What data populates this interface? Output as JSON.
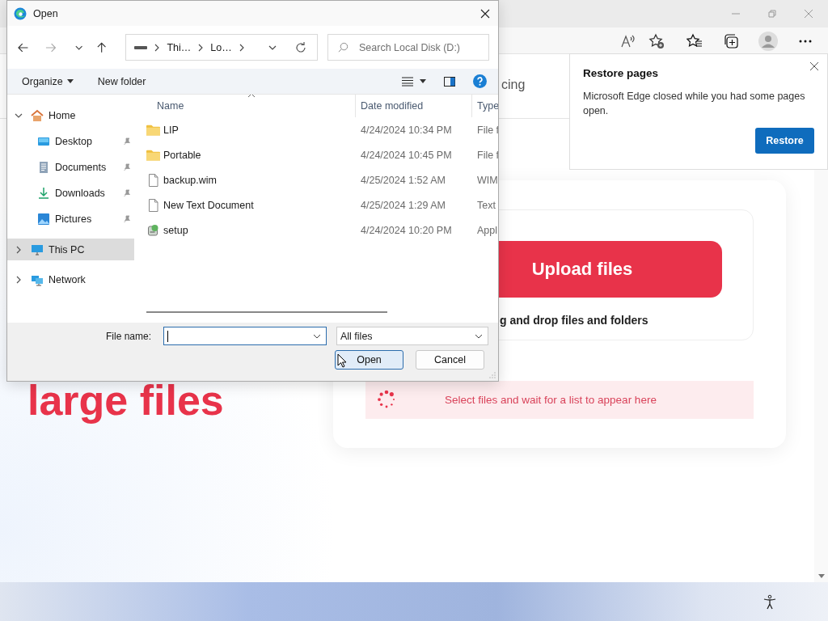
{
  "browser": {
    "page": {
      "nav_fragment": "cing",
      "heading": "large files",
      "upload_button": "Upload files",
      "drop_hint": "g and drop files and folders",
      "status": "Select files and wait for a list to appear here"
    },
    "popup": {
      "title": "Restore pages",
      "message": "Microsoft Edge closed while you had some pages open.",
      "button": "Restore"
    }
  },
  "dialog": {
    "title": "Open",
    "breadcrumb": [
      "Thi…",
      "Lo…"
    ],
    "search": {
      "placeholder": "Search Local Disk (D:)"
    },
    "commands": [
      "Organize",
      "New folder"
    ],
    "nav": [
      {
        "label": "Home",
        "kind": "home",
        "selected": false,
        "expanded": true,
        "children": [
          {
            "label": "Desktop",
            "kind": "desktop",
            "pinned": true,
            "selected": false
          },
          {
            "label": "Documents",
            "kind": "documents",
            "pinned": true,
            "selected": false
          },
          {
            "label": "Downloads",
            "kind": "downloads",
            "pinned": true,
            "selected": false
          },
          {
            "label": "Pictures",
            "kind": "pictures",
            "pinned": true,
            "selected": false
          }
        ]
      },
      {
        "label": "This PC",
        "kind": "pc",
        "selected": true,
        "expanded": false
      },
      {
        "label": "Network",
        "kind": "network",
        "selected": false,
        "expanded": false
      }
    ],
    "columns": [
      "Name",
      "Date modified",
      "Type"
    ],
    "files": [
      {
        "name": "LIP",
        "kind": "folder",
        "date": "4/24/2024 10:34 PM",
        "type": "File f"
      },
      {
        "name": "Portable",
        "kind": "folder",
        "date": "4/24/2024 10:45 PM",
        "type": "File f"
      },
      {
        "name": "backup.wim",
        "kind": "file",
        "date": "4/25/2024 1:52 AM",
        "type": "WIM"
      },
      {
        "name": "New Text Document",
        "kind": "file",
        "date": "4/25/2024 1:29 AM",
        "type": "Text"
      },
      {
        "name": "setup",
        "kind": "setup",
        "date": "4/24/2024 10:20 PM",
        "type": "Appl"
      }
    ],
    "file_name_label": "File name:",
    "file_type": "All files",
    "buttons": [
      {
        "label": "Open",
        "default": true
      },
      {
        "label": "Cancel",
        "default": false
      }
    ]
  }
}
